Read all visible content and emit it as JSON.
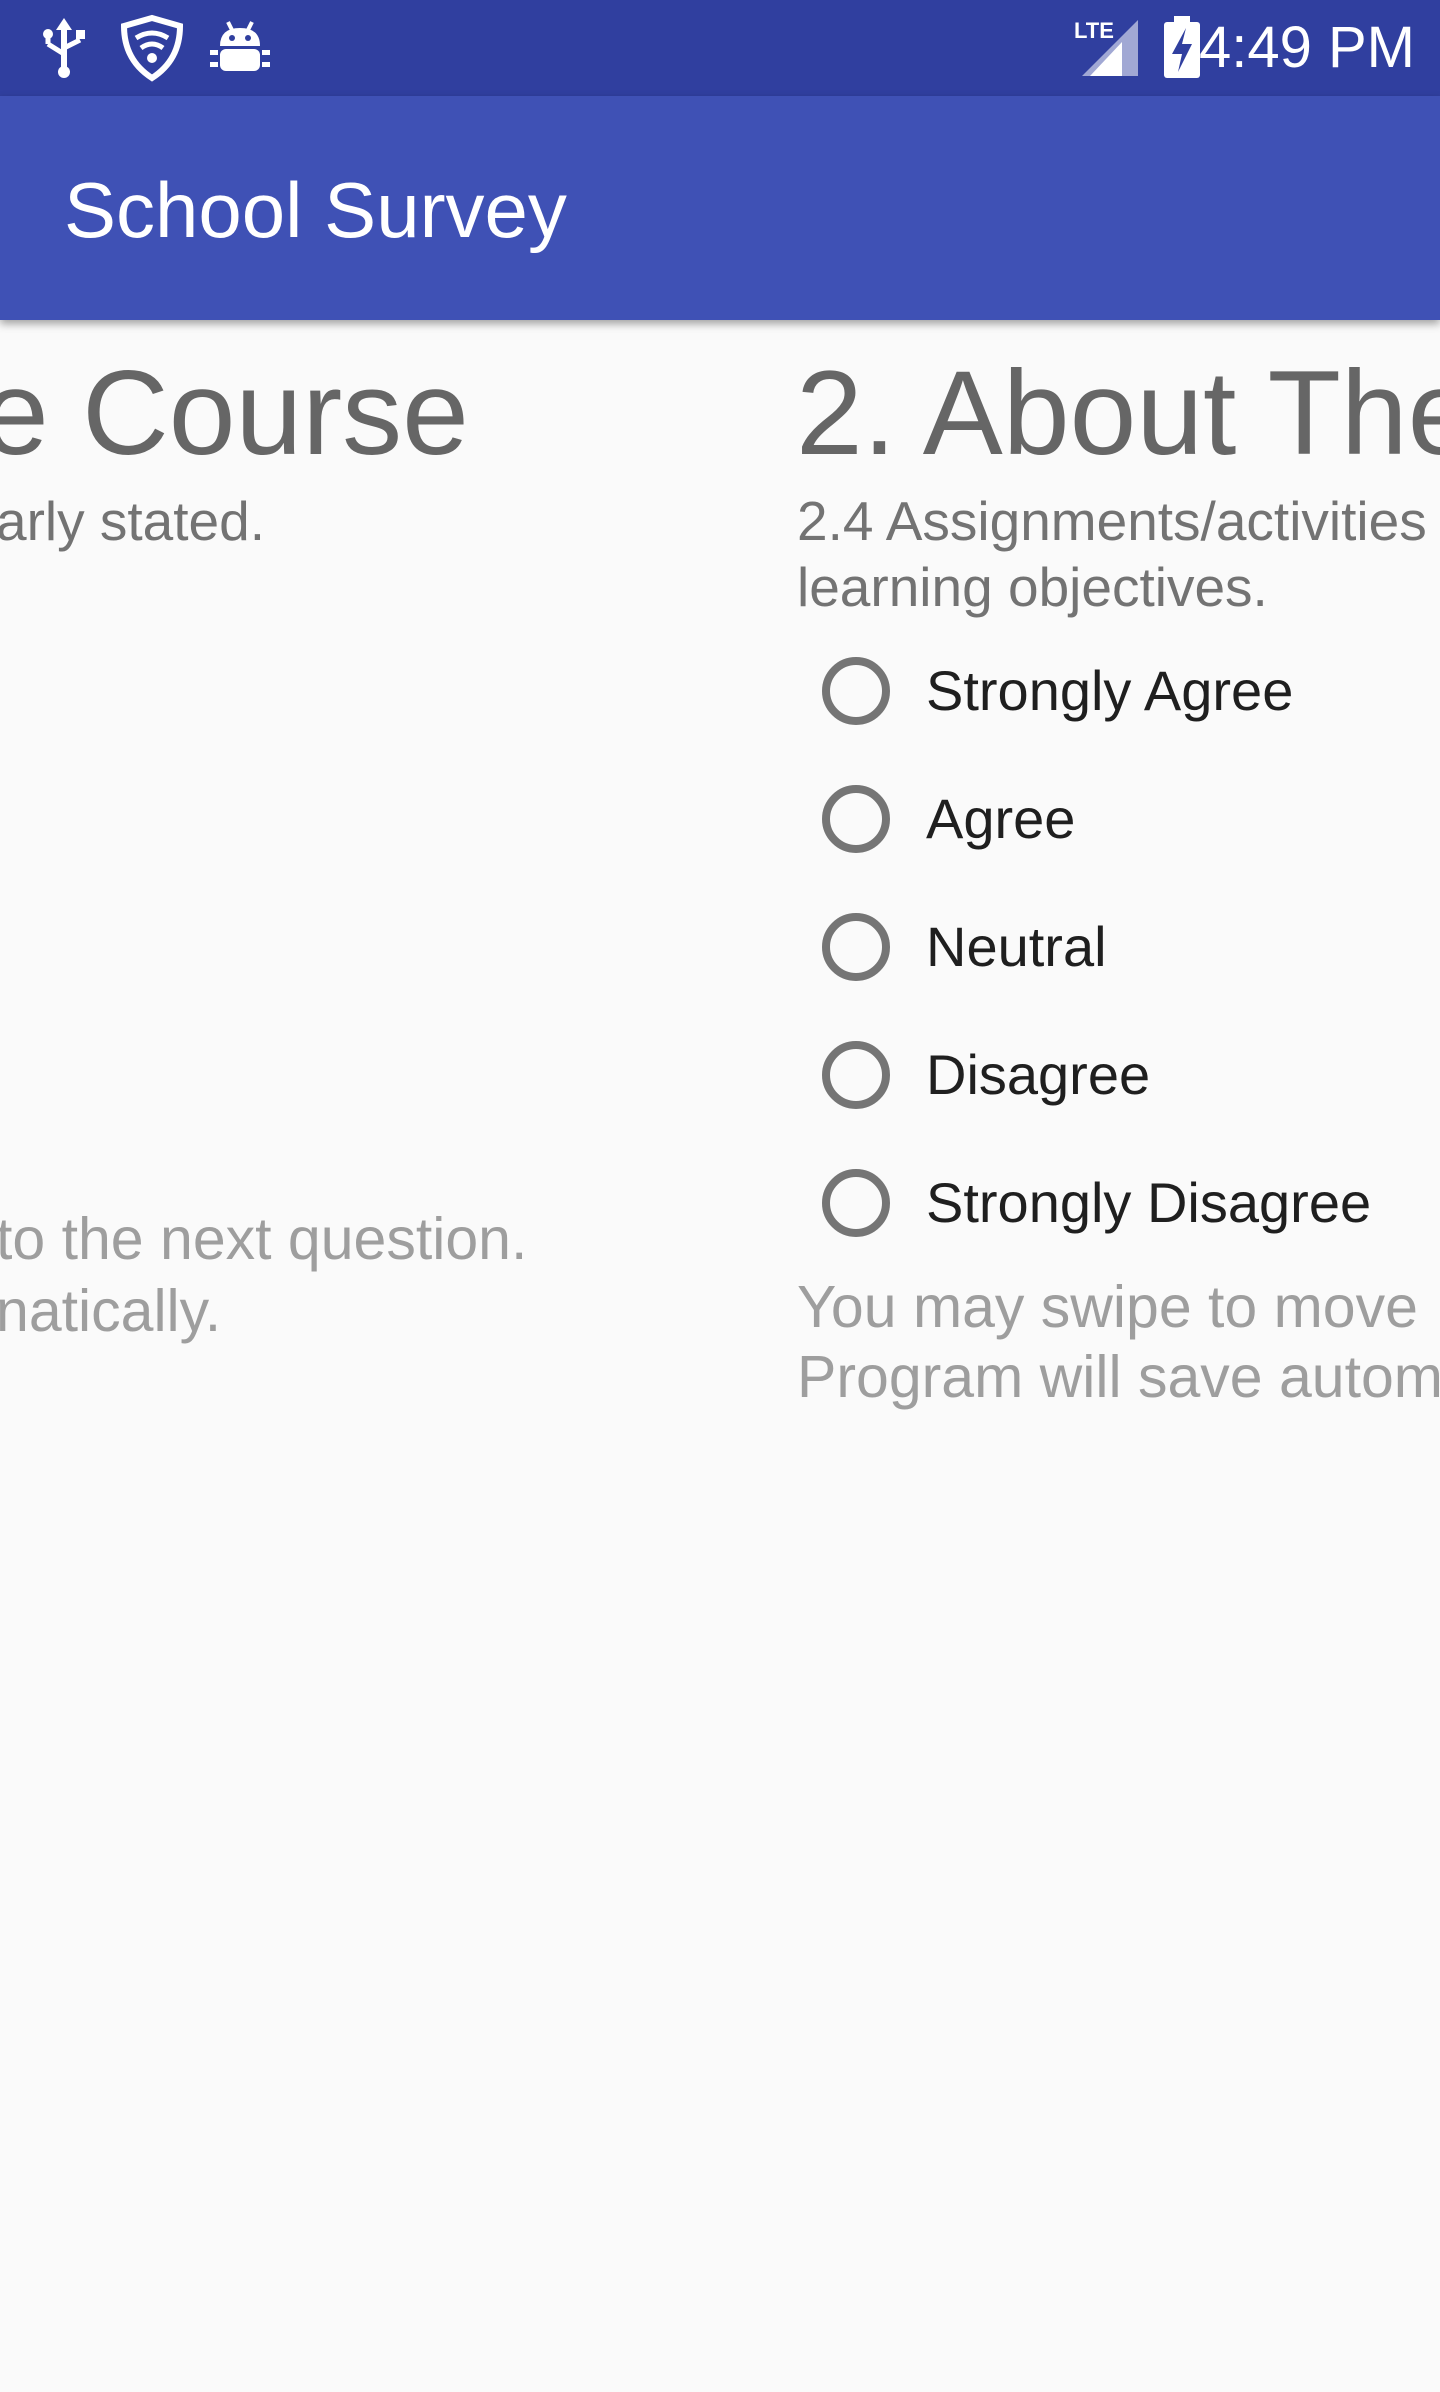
{
  "status_bar": {
    "icons": [
      "usb-icon",
      "vpn-shield-icon",
      "android-debug-icon",
      "lte-signal-icon",
      "battery-charging-icon"
    ],
    "network_label": "LTE",
    "time": "4:49 PM"
  },
  "app_bar": {
    "title": "School Survey"
  },
  "previous_page": {
    "section_title_fragment": "e Course",
    "question_fragment": "arly stated.",
    "hint_line1": "to the next question.",
    "hint_line2": "natically."
  },
  "current_page": {
    "section_title": "2. About The",
    "question_line1": "2.4 Assignments/activities",
    "question_line2": "learning objectives.",
    "options": [
      {
        "label": "Strongly Agree",
        "selected": false
      },
      {
        "label": "Agree",
        "selected": false
      },
      {
        "label": "Neutral",
        "selected": false
      },
      {
        "label": "Disagree",
        "selected": false
      },
      {
        "label": "Strongly Disagree",
        "selected": false
      }
    ],
    "hint_line1": "You may swipe to move",
    "hint_line2": "Program will save autom"
  },
  "colors": {
    "status_bar": "#303f9f",
    "app_bar": "#3f51b5",
    "background": "#fafafa",
    "title_text": "#666666",
    "radio_ring": "#757575"
  }
}
